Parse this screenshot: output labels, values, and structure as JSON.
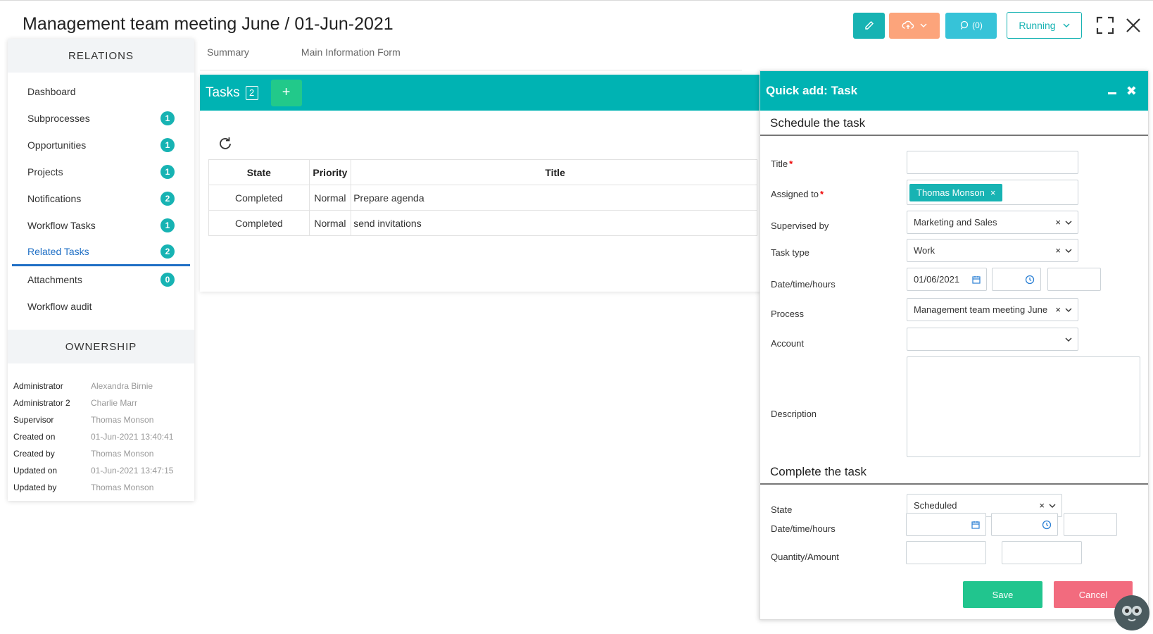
{
  "page_title": "Management team meeting June / 01-Jun-2021",
  "top_actions": {
    "comments_label": "(0)",
    "status_label": "Running"
  },
  "relations": {
    "header": "RELATIONS",
    "items": [
      {
        "label": "Dashboard",
        "count": ""
      },
      {
        "label": "Subprocesses",
        "count": "1"
      },
      {
        "label": "Opportunities",
        "count": "1"
      },
      {
        "label": "Projects",
        "count": "1"
      },
      {
        "label": "Notifications",
        "count": "2"
      },
      {
        "label": "Workflow Tasks",
        "count": "1"
      },
      {
        "label": "Related Tasks",
        "count": "2"
      },
      {
        "label": "Attachments",
        "count": "0"
      },
      {
        "label": "Workflow audit",
        "count": ""
      }
    ]
  },
  "ownership": {
    "header": "OWNERSHIP",
    "rows": [
      {
        "key": "Administrator",
        "value": "Alexandra Birnie"
      },
      {
        "key": "Administrator 2",
        "value": "Charlie Marr"
      },
      {
        "key": "Supervisor",
        "value": "Thomas Monson"
      },
      {
        "key": "Created on",
        "value": "01-Jun-2021 13:40:41"
      },
      {
        "key": "Created by",
        "value": "Thomas Monson"
      },
      {
        "key": "Updated on",
        "value": "01-Jun-2021 13:47:15"
      },
      {
        "key": "Updated by",
        "value": "Thomas Monson"
      }
    ]
  },
  "tabs": [
    "Summary",
    "Main Information Form"
  ],
  "tasks": {
    "title": "Tasks",
    "count": "2",
    "add_label": "+",
    "columns": [
      "State",
      "Priority",
      "Title"
    ],
    "rows": [
      {
        "state": "Completed",
        "priority": "Normal",
        "title": "Prepare agenda"
      },
      {
        "state": "Completed",
        "priority": "Normal",
        "title": "send invitations"
      }
    ]
  },
  "quick_add": {
    "title": "Quick add: Task",
    "section_schedule": "Schedule the task",
    "labels": {
      "title": "Title",
      "assigned_to": "Assigned to",
      "supervised_by": "Supervised by",
      "task_type": "Task type",
      "date_time_hours": "Date/time/hours",
      "process": "Process",
      "account": "Account",
      "description": "Description",
      "state": "State",
      "date_time_hours_2": "Date/time/hours",
      "quantity_amount": "Quantity/Amount"
    },
    "values": {
      "title": "",
      "assigned_to": "Thomas Monson",
      "supervised_by": "Marketing and Sales",
      "task_type": "Work",
      "date": "01/06/2021",
      "process": "Management team meeting June",
      "account": "",
      "state": "Scheduled"
    },
    "section_complete": "Complete the task",
    "save_label": "Save",
    "cancel_label": "Cancel"
  },
  "colors": {
    "teal": "#00b3b3",
    "green": "#21c58e",
    "orange": "#fca47b",
    "red": "#f26b7e",
    "link_blue": "#1f6fc5"
  }
}
